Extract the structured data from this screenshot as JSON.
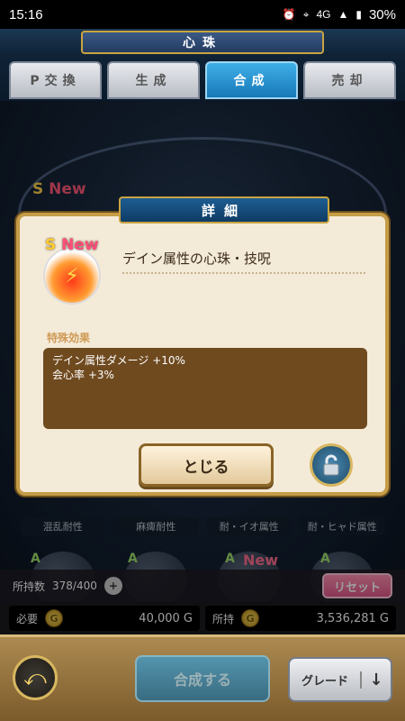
{
  "status": {
    "time": "15:16",
    "network": "4G",
    "battery": "30%"
  },
  "header": {
    "title": "心珠"
  },
  "tabs": [
    {
      "label": "P交換",
      "active": false
    },
    {
      "label": "生成",
      "active": false
    },
    {
      "label": "合成",
      "active": true
    },
    {
      "label": "売却",
      "active": false
    }
  ],
  "background": {
    "rank_badge": "S",
    "new_badge": "New",
    "stat_labels": [
      "混乱耐性",
      "麻痺耐性",
      "耐・イオ属性",
      "耐・ヒャド属性"
    ],
    "lower_ranks": [
      "A",
      "A",
      "A",
      "A"
    ],
    "lower_new": "New"
  },
  "owned": {
    "label": "所持数",
    "value": "378/400",
    "plus": "+",
    "reset_label": "リセット"
  },
  "cost": {
    "required_label": "必要",
    "required_amount": "40,000 G",
    "owned_label": "所持",
    "owned_amount": "3,536,281 G",
    "coin_glyph": "G"
  },
  "bottom": {
    "back_icon": "back-arrow-icon",
    "synth_label": "合成する",
    "grade_label": "グレード",
    "grade_arrow": "↓"
  },
  "dialog": {
    "title": "詳細",
    "rank": "S",
    "new_label": "New",
    "item_name": "デイン属性の心珠・技呪",
    "section_label": "特殊効果",
    "effects": [
      "デイン属性ダメージ +10%",
      "会心率 +3%"
    ],
    "close_label": "とじる",
    "lock_icon": "unlock-icon"
  },
  "colors": {
    "accent_blue": "#1778b8",
    "gold": "#c59c47",
    "parchment": "#f4ead8",
    "reset_pink": "#e1588a"
  }
}
